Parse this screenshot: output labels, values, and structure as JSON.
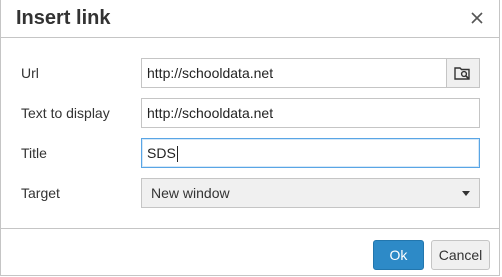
{
  "dialog": {
    "title": "Insert link",
    "close_icon": "close-icon"
  },
  "form": {
    "url": {
      "label": "Url",
      "value": "http://schooldata.net",
      "browse_icon": "browse-search-icon"
    },
    "text": {
      "label": "Text to display",
      "value": "http://schooldata.net"
    },
    "title": {
      "label": "Title",
      "value": "SDS"
    },
    "target": {
      "label": "Target",
      "selected": "New window",
      "arrow_icon": "caret-down-icon"
    }
  },
  "footer": {
    "ok_label": "Ok",
    "cancel_label": "Cancel"
  },
  "colors": {
    "primary": "#2d8ac7",
    "focus_border": "#59a5e5",
    "border": "#c5c5c5"
  }
}
